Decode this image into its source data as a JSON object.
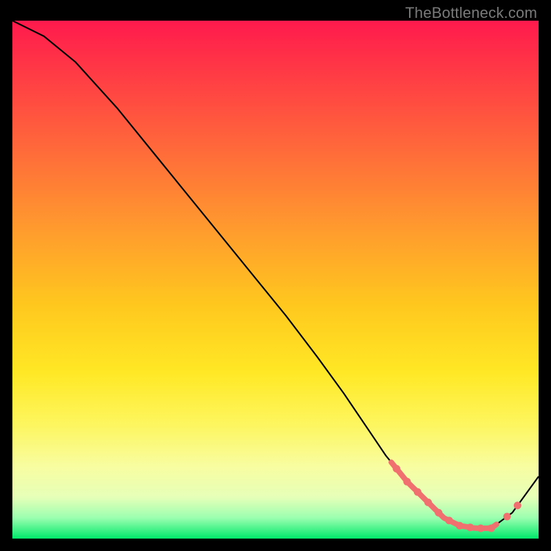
{
  "watermark": "TheBottleneck.com",
  "colors": {
    "background": "#000000",
    "gradient_top": "#ff1a4d",
    "gradient_bottom": "#00e86b",
    "curve": "#000000",
    "highlight": "#f07070"
  },
  "chart_data": {
    "type": "line",
    "title": "",
    "xlabel": "",
    "ylabel": "",
    "xlim": [
      0,
      100
    ],
    "ylim": [
      0,
      100
    ],
    "series": [
      {
        "name": "curve",
        "x": [
          0,
          6,
          12,
          20,
          28,
          36,
          44,
          52,
          58,
          63,
          67,
          71,
          75,
          79,
          82,
          85,
          88,
          91,
          95,
          100
        ],
        "values": [
          100,
          97,
          92,
          83,
          73,
          63,
          53,
          43,
          35,
          28,
          22,
          16,
          11,
          7,
          4,
          2.5,
          2,
          2,
          5,
          12
        ]
      }
    ],
    "highlight_range_x": [
      72,
      92
    ],
    "highlight_dots_x": [
      73,
      75,
      77,
      79,
      81,
      83,
      85,
      87,
      89,
      91,
      94,
      96
    ]
  }
}
